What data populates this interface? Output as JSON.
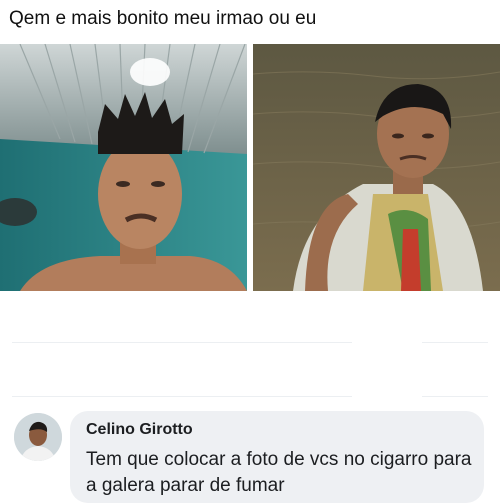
{
  "post": {
    "text": "Qem e mais bonito meu irmao ou eu"
  },
  "photos": {
    "left": {
      "subject": "man-indoor-selfie"
    },
    "right": {
      "subject": "man-river-selfie"
    }
  },
  "comment": {
    "author": "Celino Girotto",
    "text": "Tem que colocar a foto de vcs no cigarro para a galera parar de fumar"
  },
  "colors": {
    "bubble_bg": "#eef0f3",
    "wall_teal": "#2f8a8a",
    "river_brown": "#6f6346"
  }
}
